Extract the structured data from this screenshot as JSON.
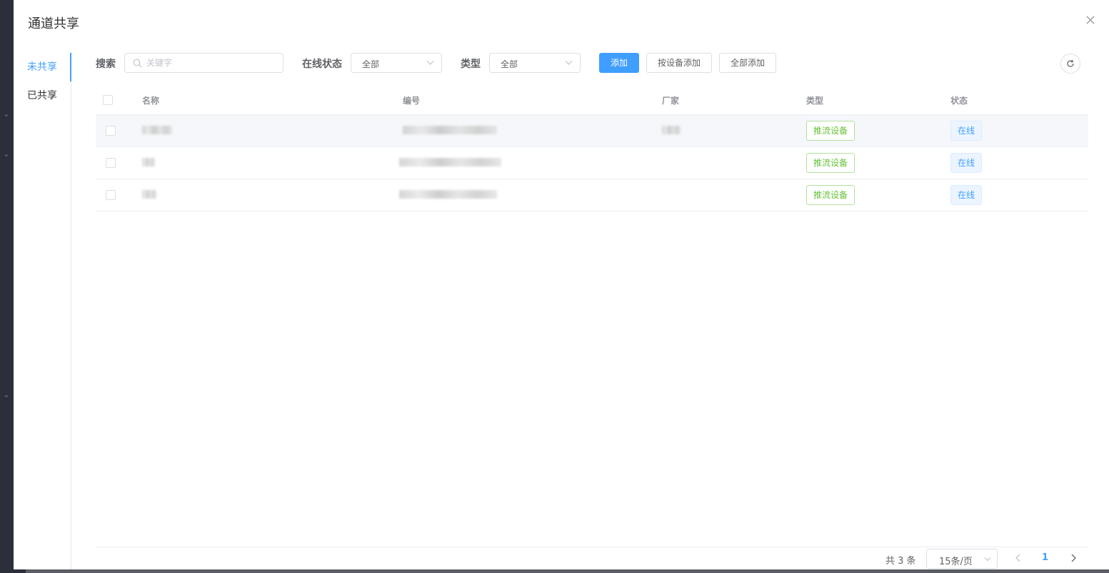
{
  "dialog": {
    "title": "通道共享"
  },
  "side_tabs": [
    {
      "label": "未共享",
      "active": true
    },
    {
      "label": "已共享",
      "active": false
    }
  ],
  "toolbar": {
    "search_label": "搜索",
    "search_placeholder": "关键字",
    "online_label": "在线状态",
    "online_value": "全部",
    "type_label": "类型",
    "type_value": "全部",
    "add_label": "添加",
    "add_by_device_label": "按设备添加",
    "add_all_label": "全部添加"
  },
  "table": {
    "columns": [
      "名称",
      "编号",
      "厂家",
      "类型",
      "状态"
    ],
    "rows": [
      {
        "type": "推流设备",
        "status": "在线"
      },
      {
        "type": "推流设备",
        "status": "在线"
      },
      {
        "type": "推流设备",
        "status": "在线"
      }
    ]
  },
  "pagination": {
    "total": "共 3 条",
    "page_size": "15条/页",
    "current_page": "1"
  },
  "colors": {
    "primary": "#409eff",
    "success": "#67c23a"
  }
}
